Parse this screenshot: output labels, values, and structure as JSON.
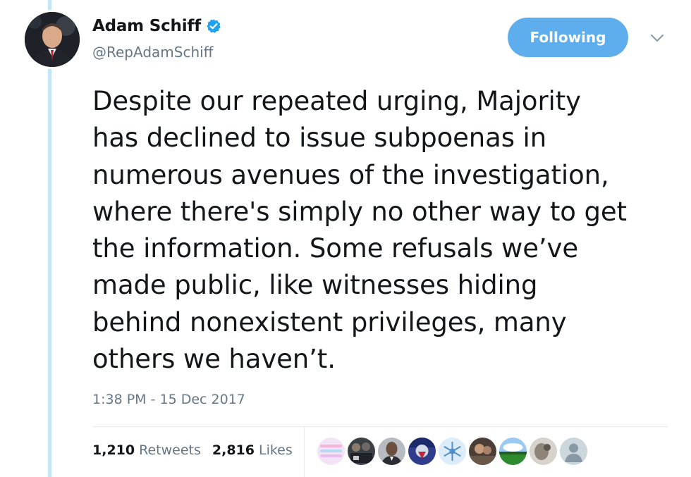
{
  "author": {
    "display_name": "Adam Schiff",
    "handle": "@RepAdamSchiff",
    "verified_icon": "verified-badge-icon"
  },
  "follow_button": {
    "label": "Following"
  },
  "caret": {
    "icon": "chevron-down-icon"
  },
  "tweet": {
    "lines": [
      "Despite our repeated urging, Majority",
      "has declined to issue subpoenas in",
      "numerous avenues of the investigation,",
      "where there's simply no other way to get",
      "the information. Some refusals we’ve",
      "made public, like witnesses hiding",
      "behind nonexistent privileges, many",
      "others we haven’t."
    ],
    "timestamp": "1:38 PM - 15 Dec 2017"
  },
  "stats": {
    "retweets": {
      "count": "1,210",
      "label": "Retweets"
    },
    "likes": {
      "count": "2,816",
      "label": "Likes"
    }
  },
  "liker_avatars": [
    "liker-avatar-1",
    "liker-avatar-2",
    "liker-avatar-3",
    "liker-avatar-4",
    "liker-avatar-5",
    "liker-avatar-6",
    "liker-avatar-7",
    "liker-avatar-8",
    "liker-avatar-9"
  ],
  "colors": {
    "follow_button_bg": "#5eadec",
    "thread_line": "#c4e4f7",
    "verified": "#1da1f2",
    "secondary_text": "#657786"
  }
}
